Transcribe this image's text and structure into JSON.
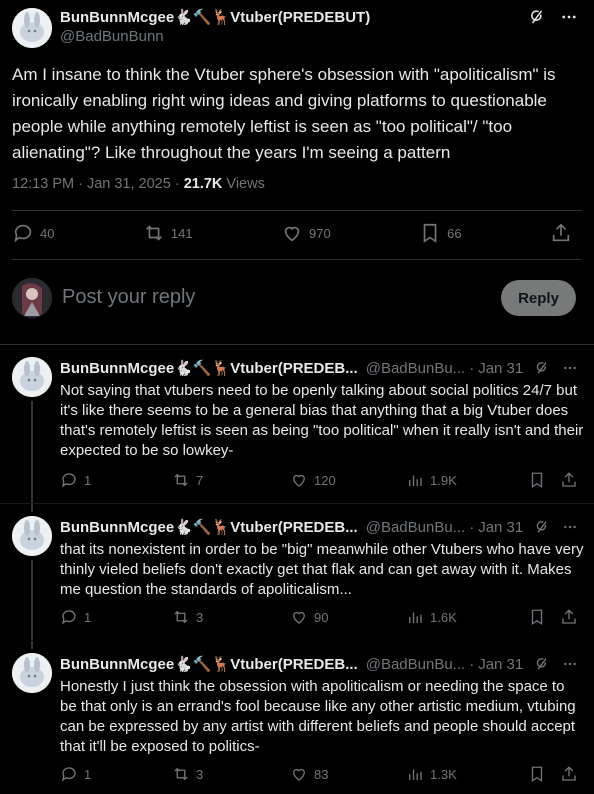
{
  "main_post": {
    "display_name": "BunBunnMcgee🐇🔨🦌Vtuber(PREDEBUT)",
    "handle": "@BadBunBunn",
    "text": "Am I insane to think the Vtuber sphere's obsession with \"apoliticalism\" is ironically enabling right wing ideas and giving platforms to questionable people while anything remotely leftist is seen as \"too political\"/ \"too alienating\"? Like throughout the years I'm seeing a pattern",
    "time": "12:13 PM · Jan 31, 2025 · ",
    "views_count": "21.7K",
    "views_label": " Views",
    "replies": "40",
    "reposts": "141",
    "likes": "970",
    "bookmarks": "66"
  },
  "reply_composer": {
    "placeholder": "Post your reply",
    "button_label": "Reply"
  },
  "replies": [
    {
      "display_name": "BunBunnMcgee🐇🔨🦌Vtuber(PREDEB...",
      "handle": "@BadBunBu...",
      "dot": "·",
      "date": "Jan 31",
      "text": "Not saying that vtubers need to be openly talking about social politics 24/7 but it's like there seems to be a general bias that anything that a big Vtuber does that's remotely leftist is seen as being \"too political\" when it really isn't and their expected to be so lowkey-",
      "replies": "1",
      "reposts": "7",
      "likes": "120",
      "views": "1.9K"
    },
    {
      "display_name": "BunBunnMcgee🐇🔨🦌Vtuber(PREDEB...",
      "handle": "@BadBunBu...",
      "dot": "·",
      "date": "Jan 31",
      "text": "that its nonexistent in order to be \"big\" meanwhile other Vtubers who have very thinly vieled beliefs don't exactly get that flak and can get away with it. Makes me question the standards of apoliticalism...",
      "replies": "1",
      "reposts": "3",
      "likes": "90",
      "views": "1.6K"
    },
    {
      "display_name": "BunBunnMcgee🐇🔨🦌Vtuber(PREDEB...",
      "handle": "@BadBunBu...",
      "dot": "·",
      "date": "Jan 31",
      "text": "Honestly I just think the obsession with apoliticalism or needing the space to be that only is an errand's fool because like any other artistic medium, vtubing can be  expressed by any artist with different beliefs and people should accept that it'll be exposed to politics-",
      "replies": "1",
      "reposts": "3",
      "likes": "83",
      "views": "1.3K"
    }
  ],
  "colors": {
    "background": "#000000",
    "text": "#e7e9ea",
    "muted": "#71767b",
    "divider": "#2f3336",
    "reply_button": "#787a7a"
  },
  "icons": [
    "grok-icon",
    "more-icon",
    "reply-icon",
    "repost-icon",
    "like-icon",
    "bookmark-icon",
    "share-icon",
    "views-icon"
  ]
}
